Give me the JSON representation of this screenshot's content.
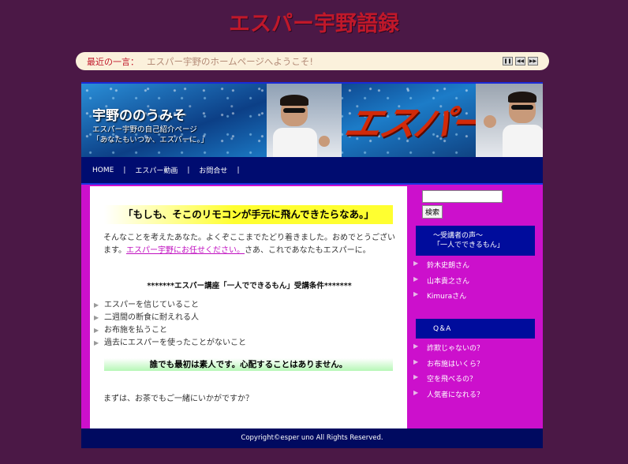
{
  "site": {
    "title": "エスパー宇野語録"
  },
  "ticker": {
    "label": "最近の一言：",
    "text": "エスパー宇野のホームページへようこそ!",
    "controls": [
      "pause",
      "prev",
      "next"
    ]
  },
  "header": {
    "site_name": "宇野ののうみそ",
    "desc_line1": "エスパー宇野の自己紹介ページ",
    "desc_line2": "「あなたもいつか、エスパーに。」",
    "logo_text": "エスパー"
  },
  "nav": {
    "items": [
      {
        "label": "HOME"
      },
      {
        "label": "エスパー動画"
      },
      {
        "label": "お問合せ"
      }
    ],
    "separator": "|"
  },
  "main": {
    "headline": "「もしも、そこのリモコンが手元に飛んできたらなあ。」",
    "para_before_link": "そんなことを考えたあなた。よくぞここまでたどり着きました。おめでとうございます。",
    "para_link": "エスパー宇野にお任せください。",
    "para_after_link": "さあ、これであなたもエスパーに。",
    "conditions_title": "*******エスパー講座「一人でできるもん」受講条件*******",
    "conditions": [
      "エスパーを信じていること",
      "二週間の断食に耐えれる人",
      "お布施を払うこと",
      "過去にエスパーを使ったことがないこと"
    ],
    "reassure": "誰でも最初は素人です。心配することはありません。",
    "closing": "まずは、お茶でもご一緒にいかがですか？"
  },
  "sidebar": {
    "search_value": "",
    "search_button": "検索",
    "voices_header_line1": "～受講者の声～",
    "voices_header_line2": "「一人でできるもん」",
    "voices": [
      "鈴木史朗さん",
      "山本貴之さん",
      "Kimuraさん"
    ],
    "qa_header": "Q＆A",
    "qa": [
      "詐欺じゃないの？",
      "お布施はいくら？",
      "空を飛べるの？",
      "人気者になれる？"
    ]
  },
  "footer": {
    "copyright": "Copyright©esper uno All Rights Reserved."
  },
  "colors": {
    "page_bg": "#4b1846",
    "title": "#c0182a",
    "frame_magenta": "#cc10cc",
    "nav_bg": "#000c70",
    "sidebar_header_bg": "#000c9c",
    "highlight_yellow": "#ffff30",
    "highlight_green": "#b6f7b6"
  }
}
